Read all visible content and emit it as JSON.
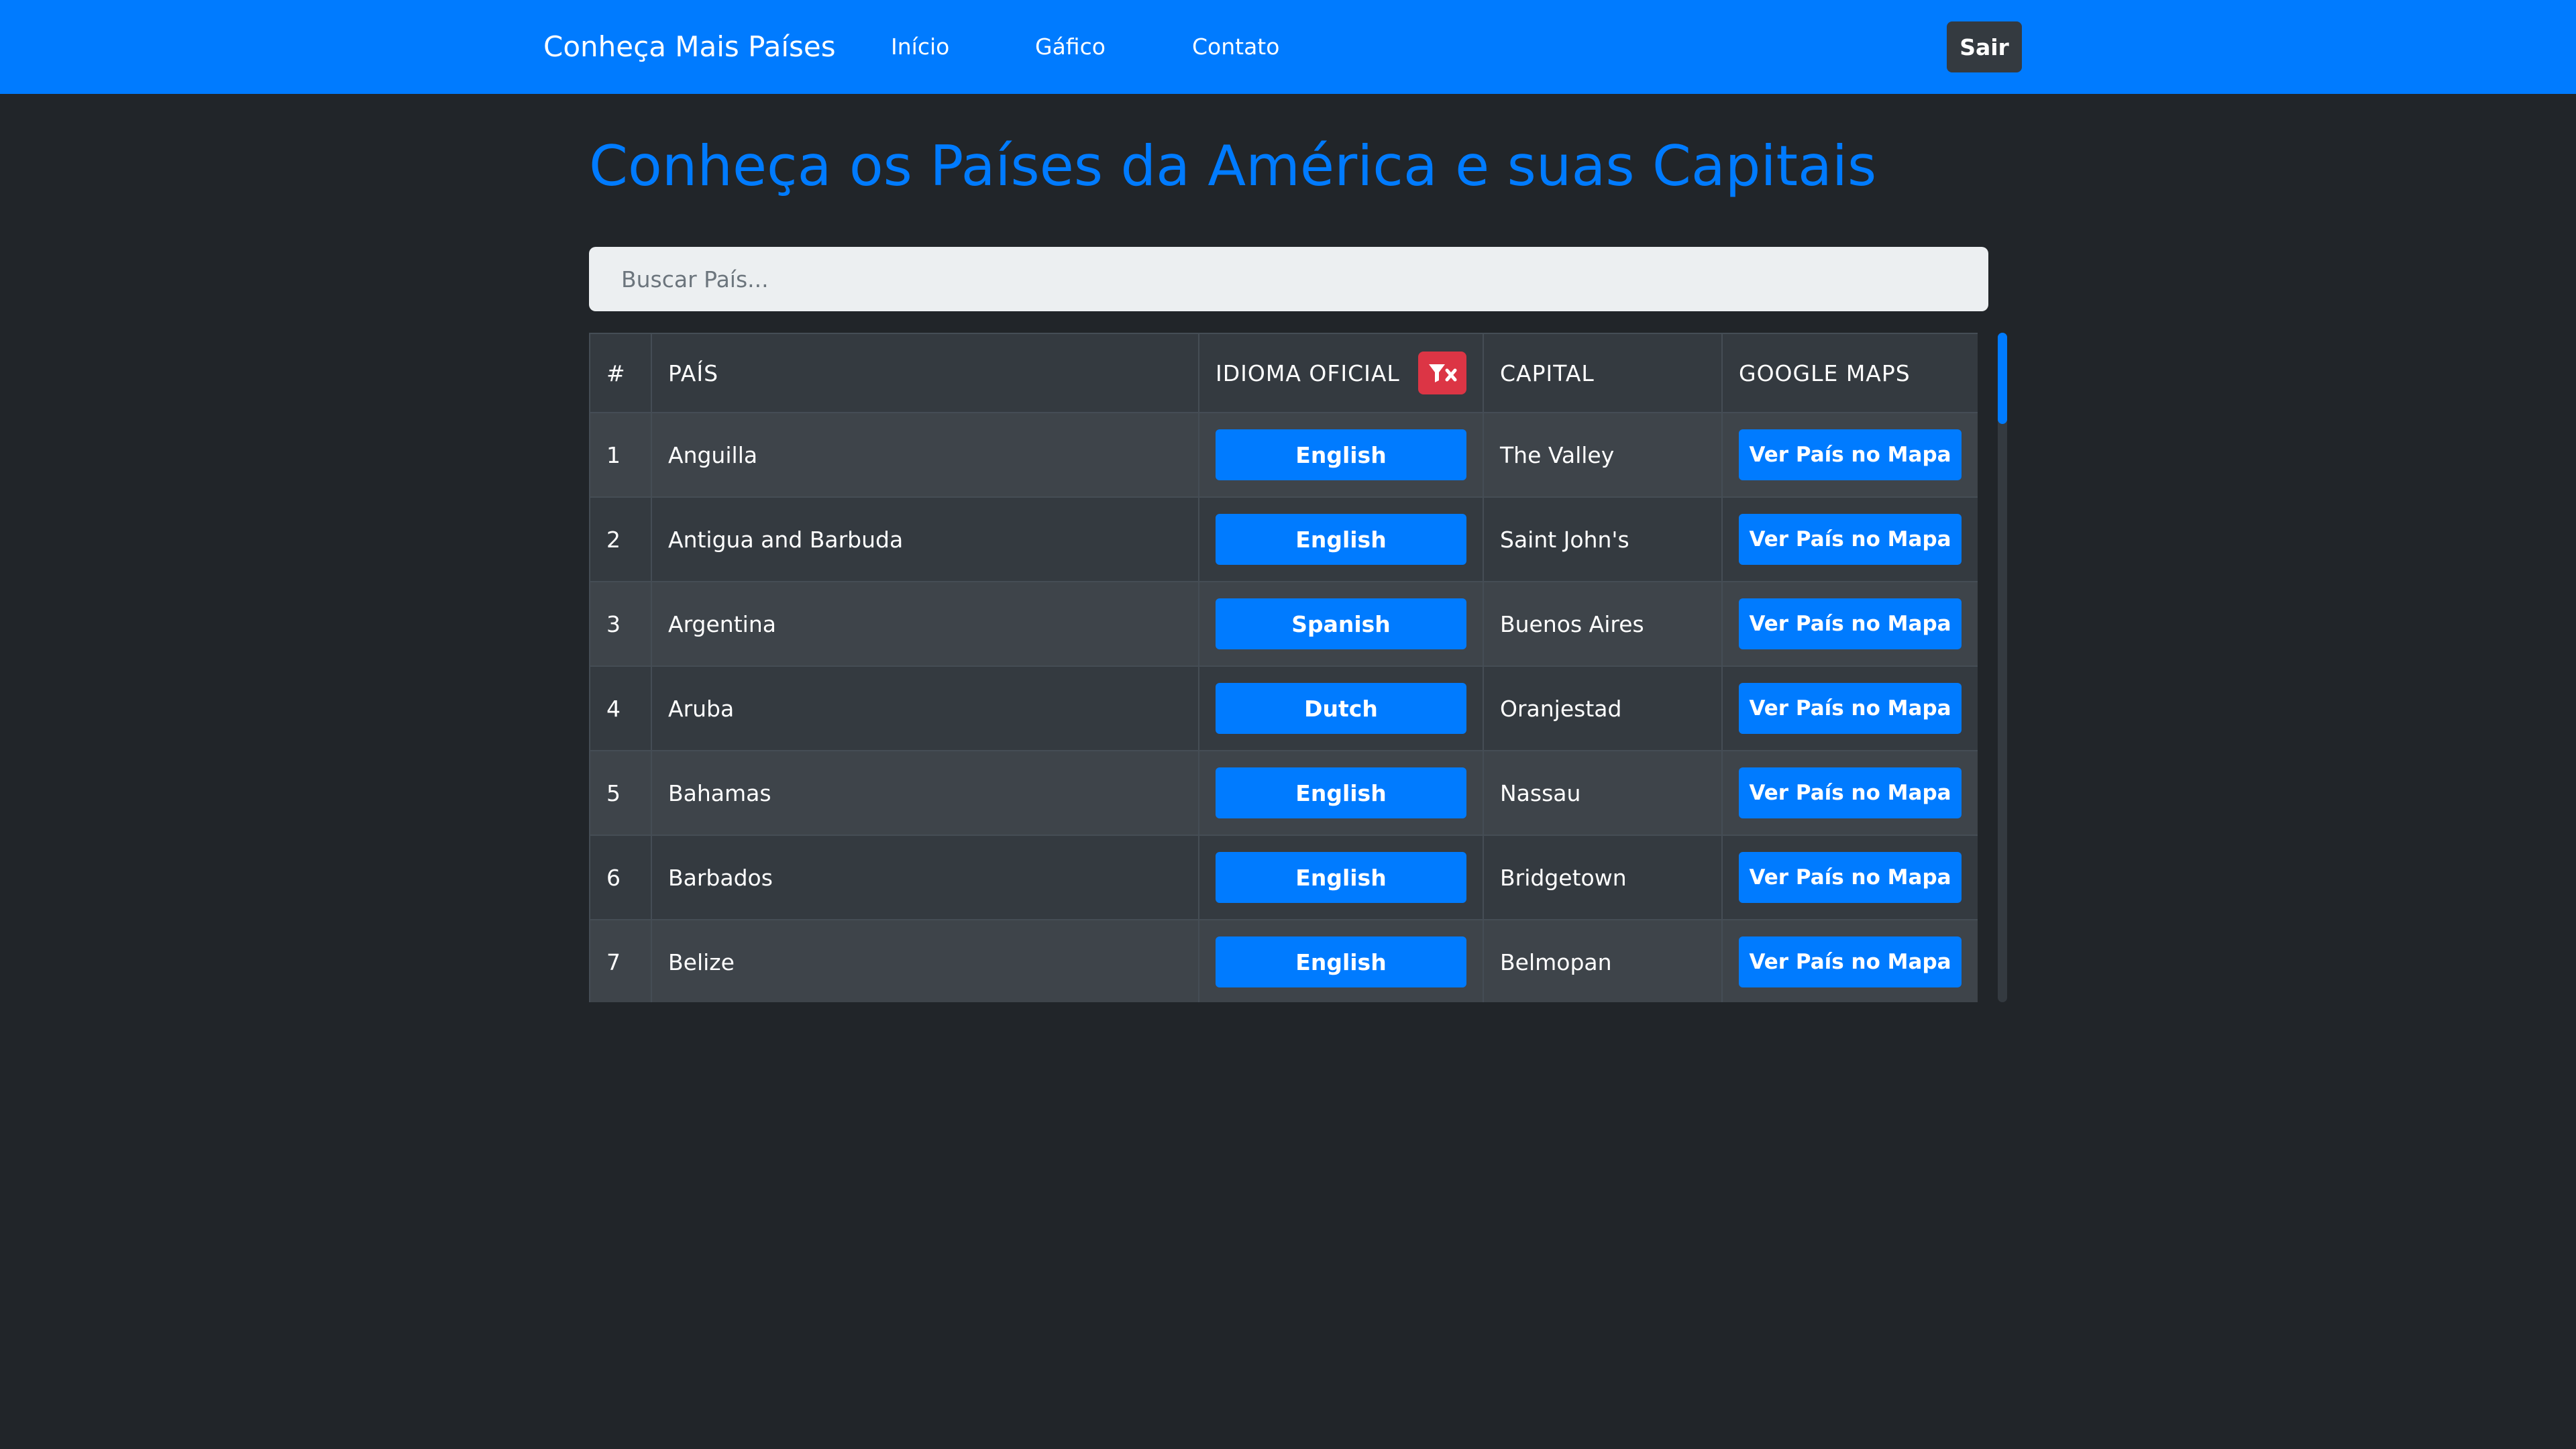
{
  "navbar": {
    "brand": "Conheça Mais Países",
    "links": [
      "Início",
      "Gáfico",
      "Contato"
    ],
    "logout_label": "Sair"
  },
  "main": {
    "title": "Conheça os Países da América e suas Capitais",
    "search_placeholder": "Buscar País...",
    "table": {
      "headers": [
        "#",
        "PAÍS",
        "IDIOMA OFICIAL",
        "CAPITAL",
        "GOOGLE MAPS"
      ],
      "map_button_label": "Ver País no Mapa",
      "rows": [
        {
          "num": "1",
          "pais": "Anguilla",
          "idioma": "English",
          "capital": "The Valley"
        },
        {
          "num": "2",
          "pais": "Antigua and Barbuda",
          "idioma": "English",
          "capital": "Saint John's"
        },
        {
          "num": "3",
          "pais": "Argentina",
          "idioma": "Spanish",
          "capital": "Buenos Aires"
        },
        {
          "num": "4",
          "pais": "Aruba",
          "idioma": "Dutch",
          "capital": "Oranjestad"
        },
        {
          "num": "5",
          "pais": "Bahamas",
          "idioma": "English",
          "capital": "Nassau"
        },
        {
          "num": "6",
          "pais": "Barbados",
          "idioma": "English",
          "capital": "Bridgetown"
        },
        {
          "num": "7",
          "pais": "Belize",
          "idioma": "English",
          "capital": "Belmopan"
        }
      ]
    }
  },
  "icons": {
    "filter_clear": "filter-clear-icon"
  },
  "colors": {
    "primary": "#007bff",
    "danger": "#dc3545",
    "background": "#212529",
    "dark": "#343a40"
  }
}
